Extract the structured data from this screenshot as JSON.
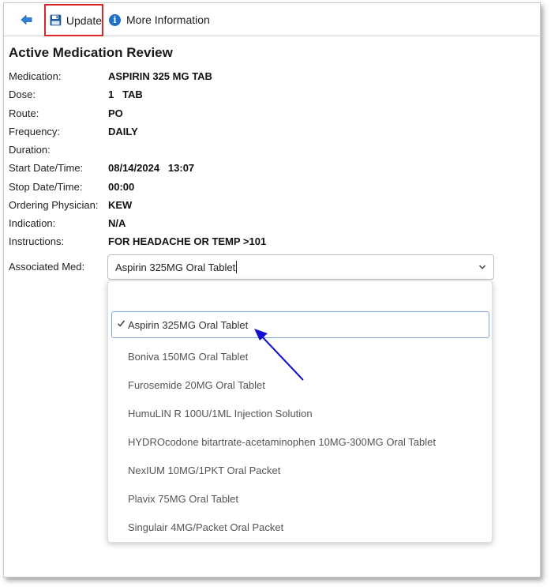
{
  "toolbar": {
    "back_icon": "back-arrow-icon",
    "update_label": "Update",
    "update_icon": "save-disk-icon",
    "info_label": "More Information",
    "info_icon": "info-icon",
    "info_glyph": "i"
  },
  "title": "Active Medication Review",
  "fields": [
    {
      "label": "Medication:",
      "value": "ASPIRIN 325 MG TAB"
    },
    {
      "label": "Dose:",
      "value": "1   TAB"
    },
    {
      "label": "Route:",
      "value": "PO"
    },
    {
      "label": "Frequency:",
      "value": "DAILY"
    },
    {
      "label": "Duration:",
      "value": ""
    },
    {
      "label": "Start Date/Time:",
      "value": "08/14/2024   13:07"
    },
    {
      "label": "Stop Date/Time:",
      "value": "00:00"
    },
    {
      "label": "Ordering Physician:",
      "value": "KEW"
    },
    {
      "label": "Indication:",
      "value": "N/A"
    },
    {
      "label": "Instructions:",
      "value": "FOR HEADACHE OR TEMP >101"
    }
  ],
  "associated_med": {
    "label": "Associated Med:",
    "value": "Aspirin 325MG Oral Tablet",
    "options": [
      {
        "label": "Aspirin 325MG Oral Tablet",
        "selected": true
      },
      {
        "label": "Boniva 150MG Oral Tablet",
        "selected": false
      },
      {
        "label": "Furosemide 20MG Oral Tablet",
        "selected": false
      },
      {
        "label": "HumuLIN R 100U/1ML Injection Solution",
        "selected": false
      },
      {
        "label": "HYDROcodone bitartrate-acetaminophen 10MG-300MG Oral Tablet",
        "selected": false
      },
      {
        "label": "NexIUM 10MG/1PKT Oral Packet",
        "selected": false
      },
      {
        "label": "Plavix 75MG Oral Tablet",
        "selected": false
      },
      {
        "label": "Singulair 4MG/Packet Oral Packet",
        "selected": false
      }
    ]
  },
  "colors": {
    "highlight_border": "#d9262a",
    "icon_blue": "#1f6fc5",
    "annotation_arrow": "#1010d0"
  }
}
